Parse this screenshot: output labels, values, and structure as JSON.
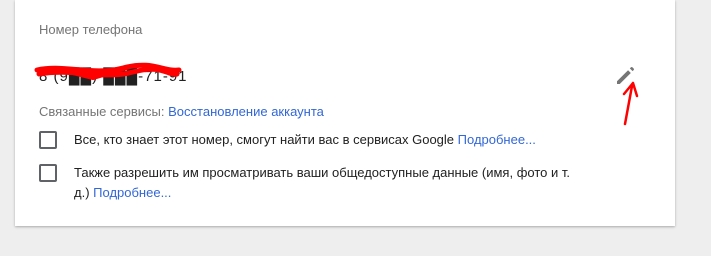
{
  "section_title": "Номер телефона",
  "phone": {
    "value": "8 (9██) ███-71-91"
  },
  "edit_icon": "pencil-icon",
  "linked_services": {
    "label": "Связанные сервисы:",
    "link": "Восстановление аккаунта"
  },
  "options": [
    {
      "text": "Все, кто знает этот номер, смогут найти вас в сервисах Google",
      "link": "Подробнее...",
      "checked": false
    },
    {
      "text": "Также разрешить им просматривать ваши общедоступные данные (имя, фото и т. д.)",
      "link": "Подробнее...",
      "checked": false
    }
  ],
  "colors": {
    "link": "#3367d6",
    "annotation": "#ff0000",
    "icon": "#757575",
    "background": "#eeeeee",
    "card": "#ffffff"
  }
}
